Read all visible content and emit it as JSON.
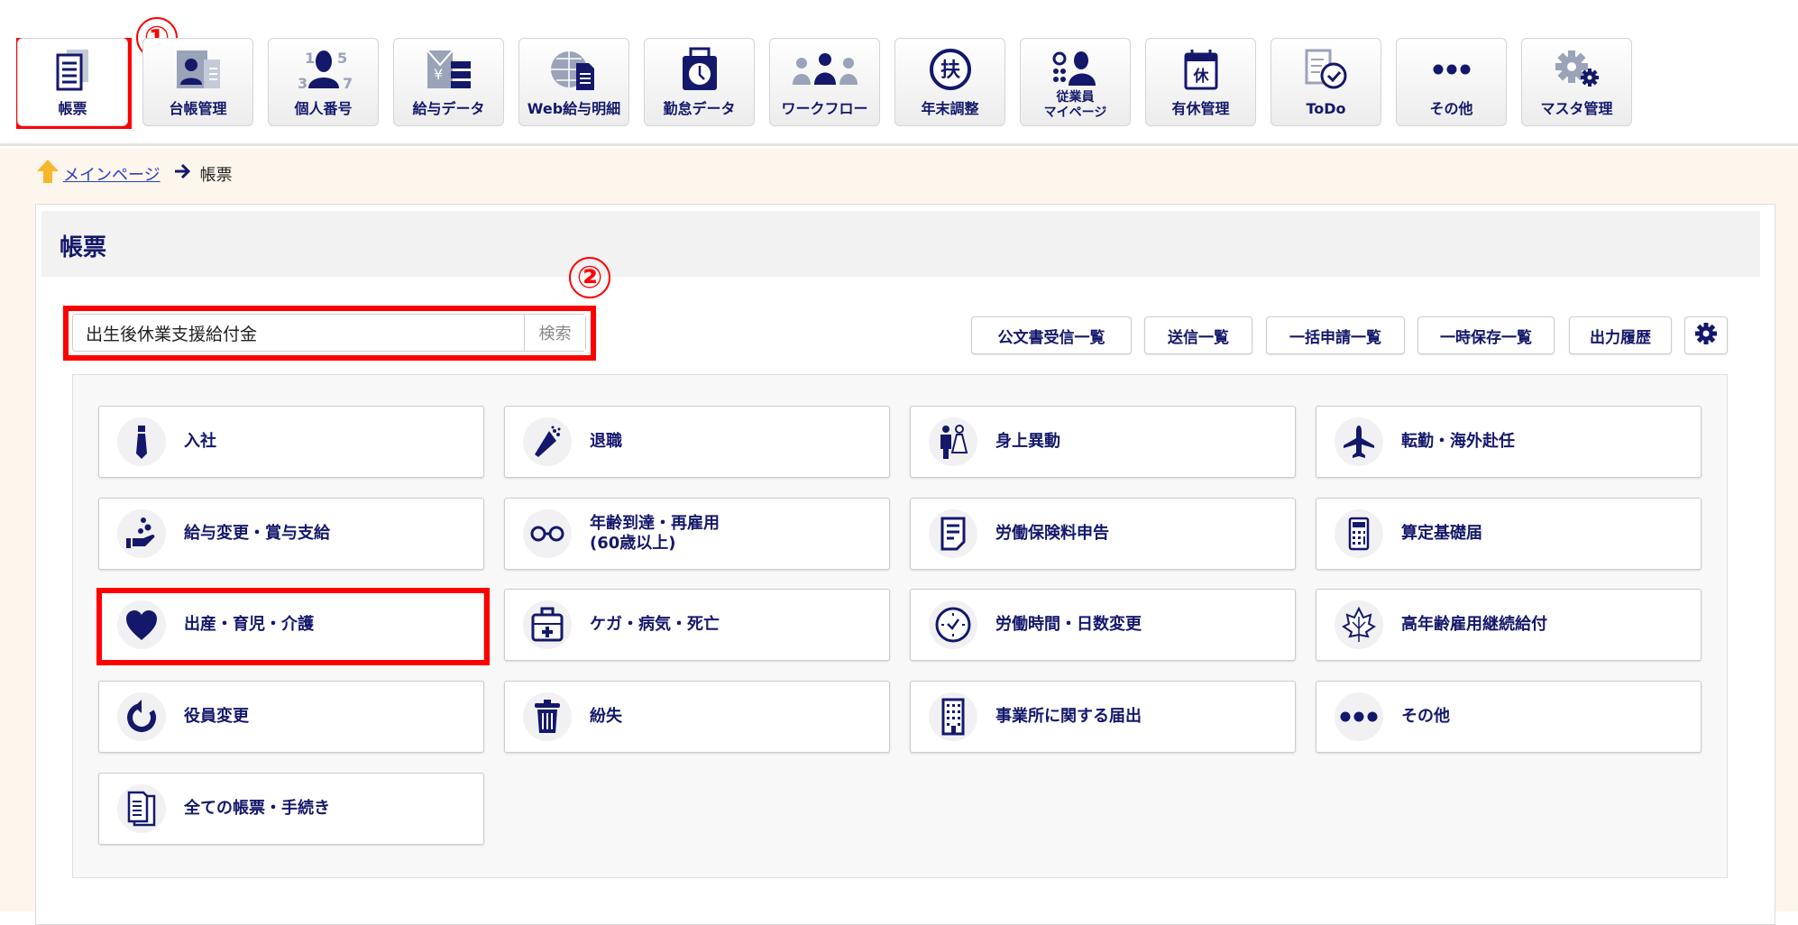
{
  "toolbar": [
    {
      "label": "帳票",
      "icon": "document-stack-icon",
      "active": true
    },
    {
      "label": "台帳管理",
      "icon": "id-card-icon"
    },
    {
      "label": "個人番号",
      "icon": "person-number-icon"
    },
    {
      "label": "給与データ",
      "icon": "salary-data-icon"
    },
    {
      "label": "Web給与明細",
      "icon": "web-payslip-icon"
    },
    {
      "label": "勤怠データ",
      "icon": "time-card-icon"
    },
    {
      "label": "ワークフロー",
      "icon": "workflow-people-icon"
    },
    {
      "label": "年末調整",
      "icon": "fu-circle-icon"
    },
    {
      "label": "従業員\nマイページ",
      "icon": "employee-mypage-icon"
    },
    {
      "label": "有休管理",
      "icon": "leave-calendar-icon"
    },
    {
      "label": "ToDo",
      "icon": "todo-check-icon"
    },
    {
      "label": "その他",
      "icon": "more-dots-icon"
    },
    {
      "label": "マスタ管理",
      "icon": "master-gears-icon"
    }
  ],
  "annotations": {
    "one": "①",
    "two": "②"
  },
  "breadcrumb": {
    "home": "メインページ",
    "current": "帳票"
  },
  "page_title": "帳票",
  "search": {
    "value": "出生後休業支援給付金",
    "button": "検索"
  },
  "actions": [
    "公文書受信一覧",
    "送信一覧",
    "一括申請一覧",
    "一時保存一覧",
    "出力履歴"
  ],
  "cards": [
    {
      "label": "入社",
      "icon": "tie-icon"
    },
    {
      "label": "退職",
      "icon": "bouquet-icon"
    },
    {
      "label": "身上異動",
      "icon": "couple-icon"
    },
    {
      "label": "転勤・海外赴任",
      "icon": "airplane-icon"
    },
    {
      "label": "給与変更・賞与支給",
      "icon": "hand-coins-icon"
    },
    {
      "label": "年齢到達・再雇用\n(60歳以上)",
      "icon": "glasses-icon"
    },
    {
      "label": "労働保険料申告",
      "icon": "form-icon"
    },
    {
      "label": "算定基礎届",
      "icon": "calculator-icon"
    },
    {
      "label": "出産・育児・介護",
      "icon": "heart-icon"
    },
    {
      "label": "ケガ・病気・死亡",
      "icon": "first-aid-icon"
    },
    {
      "label": "労働時間・日数変更",
      "icon": "clock-icon"
    },
    {
      "label": "高年齢雇用継続給付",
      "icon": "maple-leaf-icon"
    },
    {
      "label": "役員変更",
      "icon": "refresh-icon"
    },
    {
      "label": "紛失",
      "icon": "trash-icon"
    },
    {
      "label": "事業所に関する届出",
      "icon": "building-icon"
    },
    {
      "label": "その他",
      "icon": "more-dots-icon"
    },
    {
      "label": "全ての帳票・手続き",
      "icon": "documents-icon"
    }
  ],
  "colors": {
    "navy": "#14186b",
    "highlight": "#ff0000",
    "beige": "#fdf6ec"
  }
}
